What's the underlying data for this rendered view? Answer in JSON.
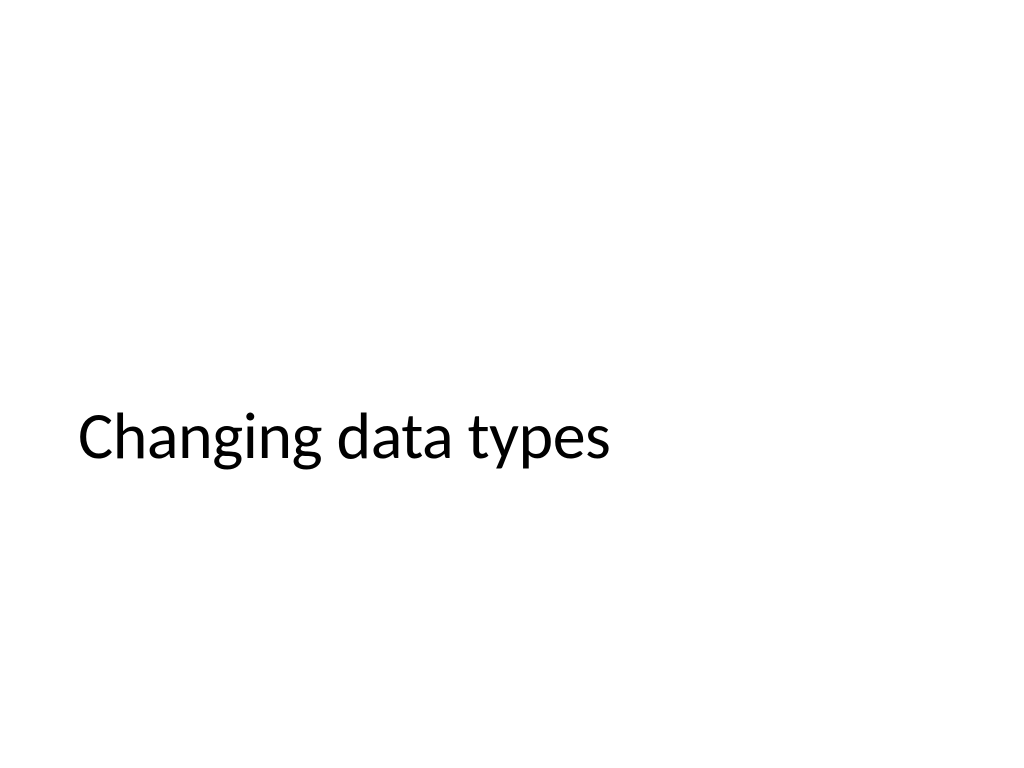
{
  "slide": {
    "title": "Changing data types"
  }
}
